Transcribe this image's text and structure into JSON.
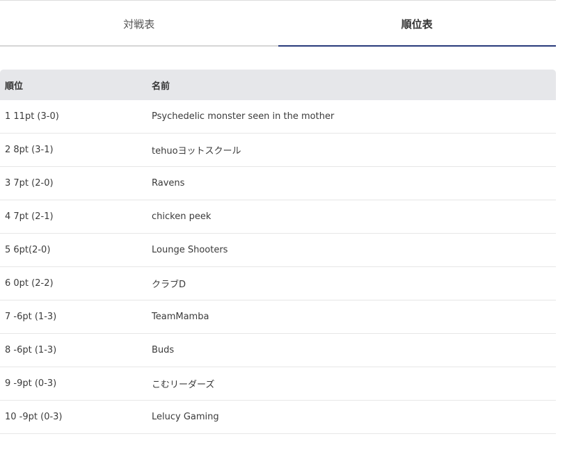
{
  "tabs": [
    {
      "label": "対戦表",
      "active": false
    },
    {
      "label": "順位表",
      "active": true
    }
  ],
  "colors": {
    "active_tab_underline": "#27397a",
    "header_background": "#e6e7ea"
  },
  "standings": {
    "headers": {
      "rank": "順位",
      "name": "名前"
    },
    "rows": [
      {
        "rank": "1 11pt (3-0)",
        "name": "Psychedelic monster seen in the mother"
      },
      {
        "rank": "2 8pt (3-1)",
        "name": "tehuoヨットスクール"
      },
      {
        "rank": "3 7pt (2-0)",
        "name": "Ravens"
      },
      {
        "rank": "4 7pt (2-1)",
        "name": "chicken peek"
      },
      {
        "rank": "5 6pt(2-0)",
        "name": "Lounge Shooters"
      },
      {
        "rank": "6 0pt (2-2)",
        "name": "クラブD"
      },
      {
        "rank": "7 -6pt (1-3)",
        "name": "TeamMamba"
      },
      {
        "rank": "8 -6pt (1-3)",
        "name": "Buds"
      },
      {
        "rank": "9 -9pt (0-3)",
        "name": "こむリーダーズ"
      },
      {
        "rank": "10 -9pt (0-3)",
        "name": "Lelucy Gaming"
      }
    ]
  }
}
